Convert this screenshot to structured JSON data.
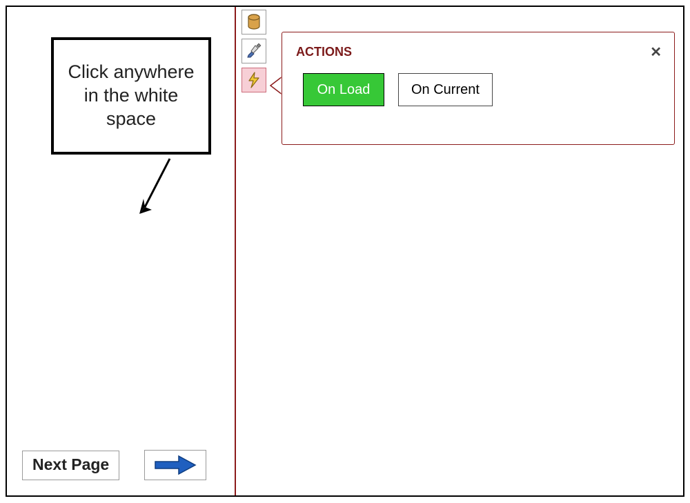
{
  "left": {
    "callout_text": "Click anywhere in the white space",
    "next_page_label": "Next Page"
  },
  "toolbar": {
    "items": [
      {
        "name": "database-icon"
      },
      {
        "name": "design-icon"
      },
      {
        "name": "actions-icon"
      }
    ]
  },
  "panel": {
    "title": "ACTIONS",
    "close_label": "✕",
    "buttons": [
      {
        "label": "On Load",
        "variant": "primary"
      },
      {
        "label": "On Current",
        "variant": "secondary"
      }
    ]
  }
}
